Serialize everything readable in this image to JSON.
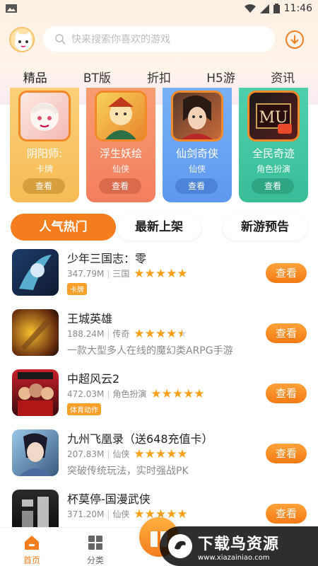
{
  "status_bar": {
    "time": "11:46"
  },
  "search": {
    "placeholder": "快来搜索你喜欢的游戏"
  },
  "tabs": [
    {
      "label": "精品",
      "active": true
    },
    {
      "label": "BT版",
      "active": false
    },
    {
      "label": "折扣",
      "active": false
    },
    {
      "label": "H5游",
      "active": false
    },
    {
      "label": "资讯",
      "active": false
    }
  ],
  "featured": [
    {
      "name": "阴阳师:",
      "category": "卡牌",
      "button": "查看",
      "color": "#f9c86a"
    },
    {
      "name": "浮生妖绘",
      "category": "仙侠",
      "button": "查看",
      "color": "#f6906b"
    },
    {
      "name": "仙剑奇侠",
      "category": "仙侠",
      "button": "查看",
      "color": "#6aa7f5"
    },
    {
      "name": "全民奇迹",
      "category": "角色扮演",
      "button": "查看",
      "color": "#45c8a5"
    }
  ],
  "segments": [
    {
      "label": "人气热门",
      "active": true
    },
    {
      "label": "最新上架",
      "active": false
    },
    {
      "label": "新游预告",
      "active": false
    }
  ],
  "games": [
    {
      "title": "少年三国志：零",
      "size": "347.79M",
      "category": "三国",
      "rating": 5,
      "tag": "卡牌",
      "desc": "",
      "button": "查看"
    },
    {
      "title": "王城英雄",
      "size": "188.24M",
      "category": "传奇",
      "rating": 4.5,
      "tag": "",
      "desc": "一款大型多人在线的魔幻类ARPG手游",
      "button": "查看"
    },
    {
      "title": "中超风云2",
      "size": "472.03M",
      "category": "角色扮演",
      "rating": 5,
      "tag": "体育动作",
      "desc": "",
      "button": "查看"
    },
    {
      "title": "九州飞凰录（送648充值卡）",
      "size": "207.83M",
      "category": "仙侠",
      "rating": 5,
      "tag": "",
      "desc": "突破传统玩法，实时强战PK",
      "button": "查看"
    },
    {
      "title": "杯莫停-国漫武侠",
      "size": "371.20M",
      "category": "仙侠",
      "rating": 5,
      "tag": "",
      "desc": "",
      "button": "查看"
    }
  ],
  "bottom_nav": [
    {
      "label": "首页",
      "icon": "home-icon",
      "active": true
    },
    {
      "label": "分类",
      "icon": "grid-icon",
      "active": false
    }
  ],
  "watermark": {
    "title": "下载鸟资源",
    "url": "www.xiazainiao.com"
  },
  "colors": {
    "accent": "#f47d1e",
    "star": "#f9a01b"
  }
}
